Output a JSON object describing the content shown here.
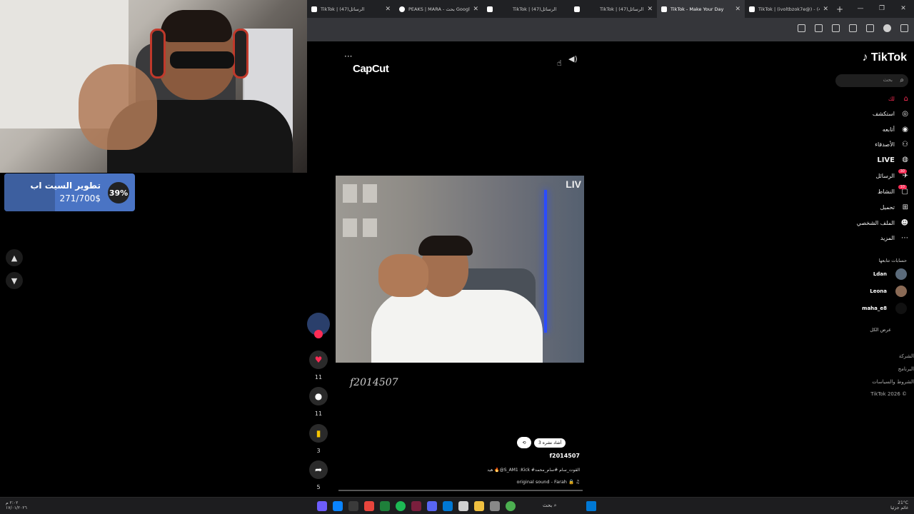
{
  "goal": {
    "title": "تطوير السيت اب",
    "amount": "271/700$",
    "percent_label": "39%",
    "percent": 39
  },
  "browser": {
    "tabs": [
      {
        "label": "TikTok | (47)الرسائل",
        "active": false
      },
      {
        "label": "PEAKS | MARA - بحث Google",
        "active": false
      },
      {
        "label": "",
        "active": false
      },
      {
        "label": "TikTok | (47)الرسائل",
        "active": false
      },
      {
        "label": "",
        "active": false
      },
      {
        "label": "TikTok | (47)الرسائل",
        "active": false
      },
      {
        "label": "TikTok - Make Your Day",
        "active": true
      },
      {
        "label": "TikTok | (ivoltbzok7e@) - (47)",
        "active": false
      }
    ],
    "new_tab": "+",
    "window_controls": [
      "—",
      "❐",
      "✕"
    ]
  },
  "player": {
    "more": "···",
    "watermark": "CapCut",
    "corner_logo": "LIV",
    "handle_overlay": "f2014507",
    "actions": {
      "likes": "11",
      "comments": "11",
      "saves": "3",
      "shares": "5"
    },
    "repost_pill": "3 أشاد نشره",
    "author": "f2014507",
    "description": "هيد 🔥@S_AM1 :Kick #القوت_سام #سام_محمد",
    "sound": "original sound - Farah 🔒"
  },
  "sidebar": {
    "brand": "TikTok",
    "search_placeholder": "بحث",
    "nav": [
      {
        "label": "لك",
        "icon": "home-icon"
      },
      {
        "label": "استكشف",
        "icon": "compass-icon"
      },
      {
        "label": "أتابعه",
        "icon": "following-icon"
      },
      {
        "label": "الأصدقاء",
        "icon": "friends-icon"
      },
      {
        "label": "LIVE",
        "icon": "live-icon"
      },
      {
        "label": "الرسائل",
        "icon": "messages-icon",
        "badge": "30"
      },
      {
        "label": "النشاط",
        "icon": "activity-icon",
        "badge": "10"
      },
      {
        "label": "تحميل",
        "icon": "upload-icon"
      },
      {
        "label": "الملف الشخصي",
        "icon": "profile-icon"
      },
      {
        "label": "المزيد",
        "icon": "more-icon"
      }
    ],
    "following_title": "حسابات تتابعها",
    "following": [
      "Ldan",
      "Leona",
      "maha_e8"
    ],
    "see_all": "عرض الكل",
    "footer": [
      "الشركة",
      "البرنامج",
      "الشروط والسياسات",
      "TikTok 2026 ©"
    ]
  },
  "taskbar": {
    "left_time": "٢:٠٢ م\n١٧/٠١/٢٠٢٦",
    "search": "بحث",
    "weather": "21°C\nغائم جزئيا"
  }
}
